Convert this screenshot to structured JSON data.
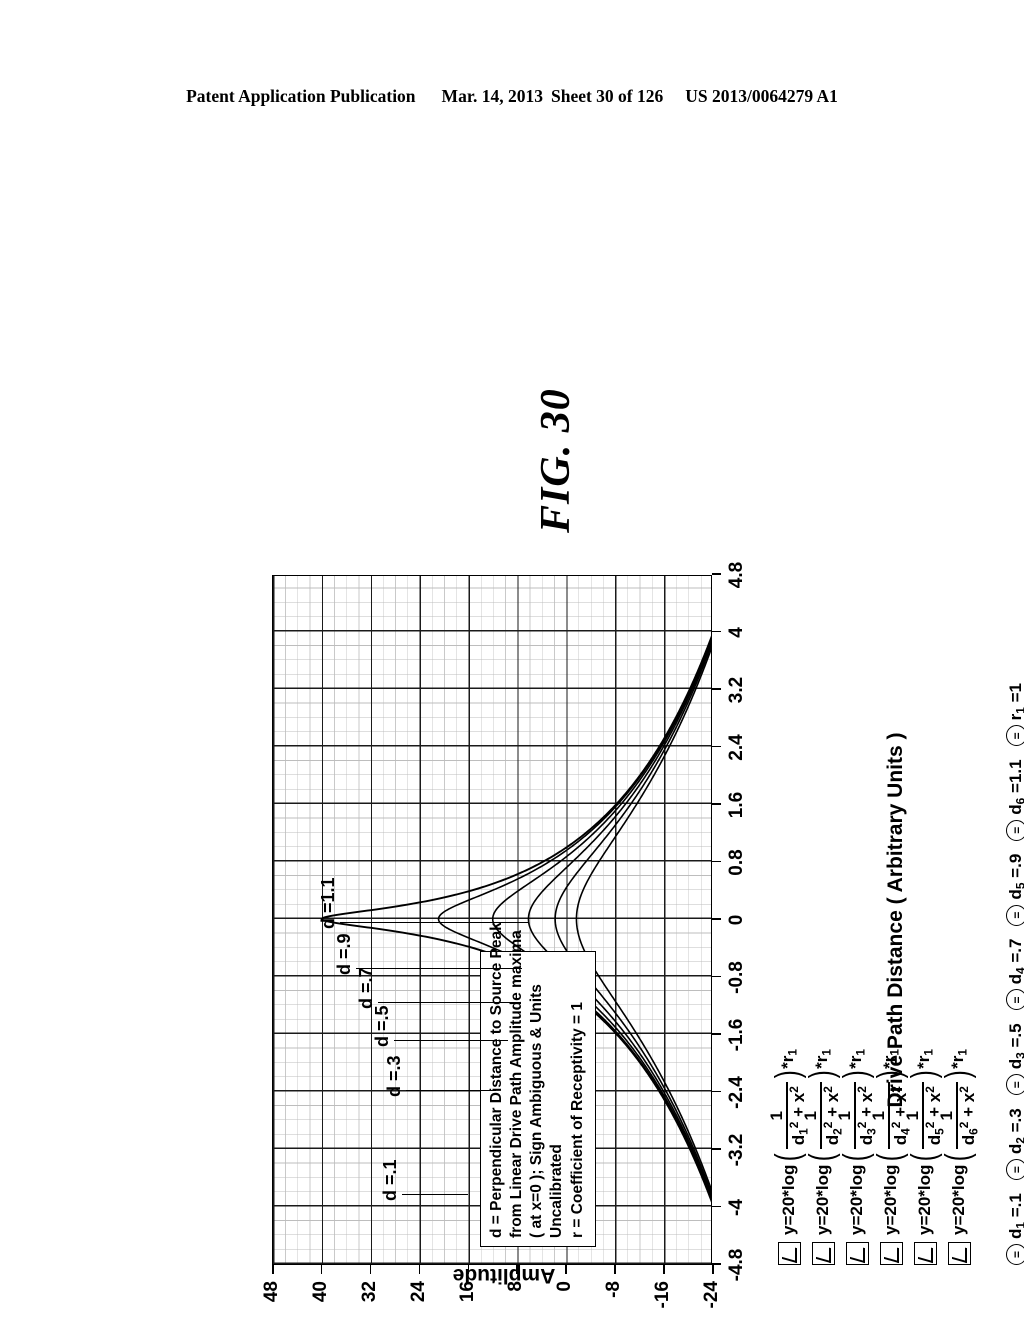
{
  "header": {
    "publication": "Patent Application Publication",
    "date": "Mar. 14, 2013",
    "sheet": "Sheet 30 of 126",
    "docnum": "US 2013/0064279 A1"
  },
  "figure": {
    "caption": "FIG. 30"
  },
  "notes": {
    "line1": "d = Perpendicular Distance to Source Peak",
    "line2": "from Linear Drive Path Amplitude maxima",
    "line3": "( at x=0 );  Sign Ambiguous & Units",
    "line4": "Uncalibrated",
    "line5": "r = Coefficient of Receptivity = 1"
  },
  "curve_labels": [
    {
      "text": "d =.1"
    },
    {
      "text": "d =.3"
    },
    {
      "text": "d =.5"
    },
    {
      "text": "d =.7"
    },
    {
      "text": "d =.9"
    },
    {
      "text": "d =1.1"
    }
  ],
  "formulas": [
    {
      "lead": "y=20*log",
      "num": "1",
      "den_d": "d",
      "den_sub": "1",
      "den_rest": "+ x",
      "tail_r": "r",
      "tail_sub": "1"
    },
    {
      "lead": "y=20*log",
      "num": "1",
      "den_d": "d",
      "den_sub": "2",
      "den_rest": "+ x",
      "tail_r": "r",
      "tail_sub": "1"
    },
    {
      "lead": "y=20*log",
      "num": "1",
      "den_d": "d",
      "den_sub": "3",
      "den_rest": "+ x",
      "tail_r": "r",
      "tail_sub": "1"
    },
    {
      "lead": "y=20*log",
      "num": "1",
      "den_d": "d",
      "den_sub": "4",
      "den_rest": "+ x",
      "tail_r": "r",
      "tail_sub": "1"
    },
    {
      "lead": "y=20*log",
      "num": "1",
      "den_d": "d",
      "den_sub": "5",
      "den_rest": "+ x",
      "tail_r": "r",
      "tail_sub": "1"
    },
    {
      "lead": "y=20*log",
      "num": "1",
      "den_d": "d",
      "den_sub": "6",
      "den_rest": "+ x",
      "tail_r": "r",
      "tail_sub": "1"
    }
  ],
  "variables": [
    {
      "name": "d",
      "sub": "1",
      "value": "=.1"
    },
    {
      "name": "d",
      "sub": "2",
      "value": "=.3"
    },
    {
      "name": "d",
      "sub": "3",
      "value": "=.5"
    },
    {
      "name": "d",
      "sub": "4",
      "value": "=.7"
    },
    {
      "name": "d",
      "sub": "5",
      "value": "=.9"
    },
    {
      "name": "d",
      "sub": "6",
      "value": "=1.1"
    },
    {
      "name": "r",
      "sub": "1",
      "value": "=1"
    }
  ],
  "chart_data": {
    "type": "line",
    "title": "FIG. 30",
    "xlabel": "Drive Path Distance  ( Arbitrary Units )",
    "ylabel": "Amplitude",
    "xlim": [
      -4.8,
      4.8
    ],
    "ylim": [
      -24,
      48
    ],
    "xticks": [
      "-4.8",
      "-4",
      "-3.2",
      "-2.4",
      "-1.6",
      "-0.8",
      "0",
      "0.8",
      "1.6",
      "2.4",
      "3.2",
      "4",
      "4.8"
    ],
    "xtick_values": [
      -4.8,
      -4,
      -3.2,
      -2.4,
      -1.6,
      -0.8,
      0,
      0.8,
      1.6,
      2.4,
      3.2,
      4,
      4.8
    ],
    "yticks": [
      "-24",
      "-16",
      "-8",
      "0",
      "8",
      "16",
      "24",
      "32",
      "40",
      "48"
    ],
    "ytick_values": [
      -24,
      -16,
      -8,
      0,
      8,
      16,
      24,
      32,
      40,
      48
    ],
    "grid": true,
    "legend_position": "inside-plot-annotation",
    "equation": "y = 20*log( 1 / (d^2 + x^2) ) * r",
    "r": 1,
    "series": [
      {
        "name": "d =.1",
        "d": 0.1,
        "peak_value": 40.0
      },
      {
        "name": "d =.3",
        "d": 0.3,
        "peak_value": 20.9
      },
      {
        "name": "d =.5",
        "d": 0.5,
        "peak_value": 12.0
      },
      {
        "name": "d =.7",
        "d": 0.7,
        "peak_value": 6.1
      },
      {
        "name": "d =.9",
        "d": 0.9,
        "peak_value": 1.8
      },
      {
        "name": "d =1.1",
        "d": 1.1,
        "peak_value": -1.7
      }
    ],
    "x_samples": [
      -4.8,
      -4.4,
      -4.0,
      -3.6,
      -3.2,
      -2.8,
      -2.4,
      -2.0,
      -1.6,
      -1.2,
      -0.8,
      -0.4,
      0,
      0.4,
      0.8,
      1.2,
      1.6,
      2.0,
      2.4,
      2.8,
      3.2,
      3.6,
      4.0,
      4.4,
      4.8
    ],
    "notes": [
      "d = Perpendicular Distance to Source Peak",
      "from Linear Drive Path Amplitude maxima",
      "( at x=0 );  Sign Ambiguous & Units",
      "Uncalibrated",
      "r = Coefficient of Receptivity = 1"
    ]
  }
}
